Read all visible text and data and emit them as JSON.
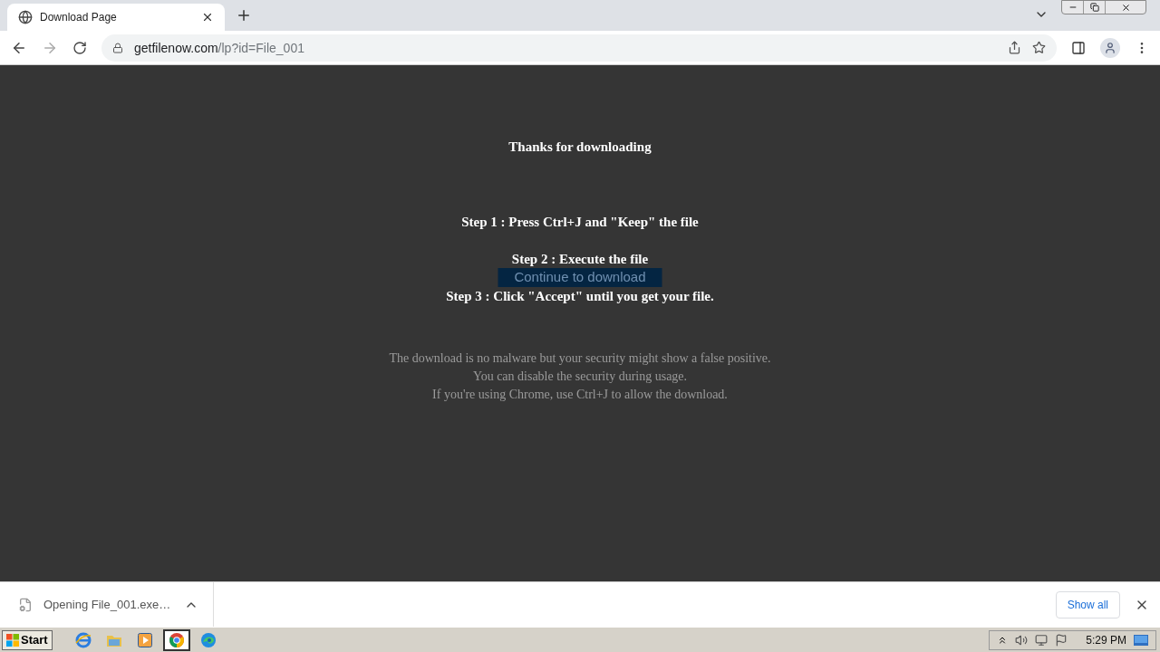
{
  "browser": {
    "tab": {
      "title": "Download Page"
    },
    "url": {
      "host": "getfilenow.com",
      "path": "/lp?id=File_001"
    }
  },
  "page": {
    "heading": "Thanks for downloading",
    "steps": [
      "Step 1 : Press Ctrl+J and \"Keep\" the file",
      "Step 2 : Execute the file",
      "Step 3 : Click \"Accept\" until you get your file."
    ],
    "button": "Continue to download",
    "notice": [
      "The download is no malware but your security might show a false positive.",
      "You can disable the security during usage.",
      "If you're using Chrome, use Ctrl+J to allow the download."
    ]
  },
  "download_bar": {
    "item": "Opening File_001.exe…",
    "show_all": "Show all"
  },
  "taskbar": {
    "start": "Start",
    "apps": [
      {
        "kind": "ie",
        "selected": false
      },
      {
        "kind": "folder",
        "selected": false
      },
      {
        "kind": "media",
        "selected": false
      },
      {
        "kind": "chrome",
        "selected": true
      },
      {
        "kind": "edge",
        "selected": false
      }
    ],
    "clock": "5:29 PM"
  }
}
